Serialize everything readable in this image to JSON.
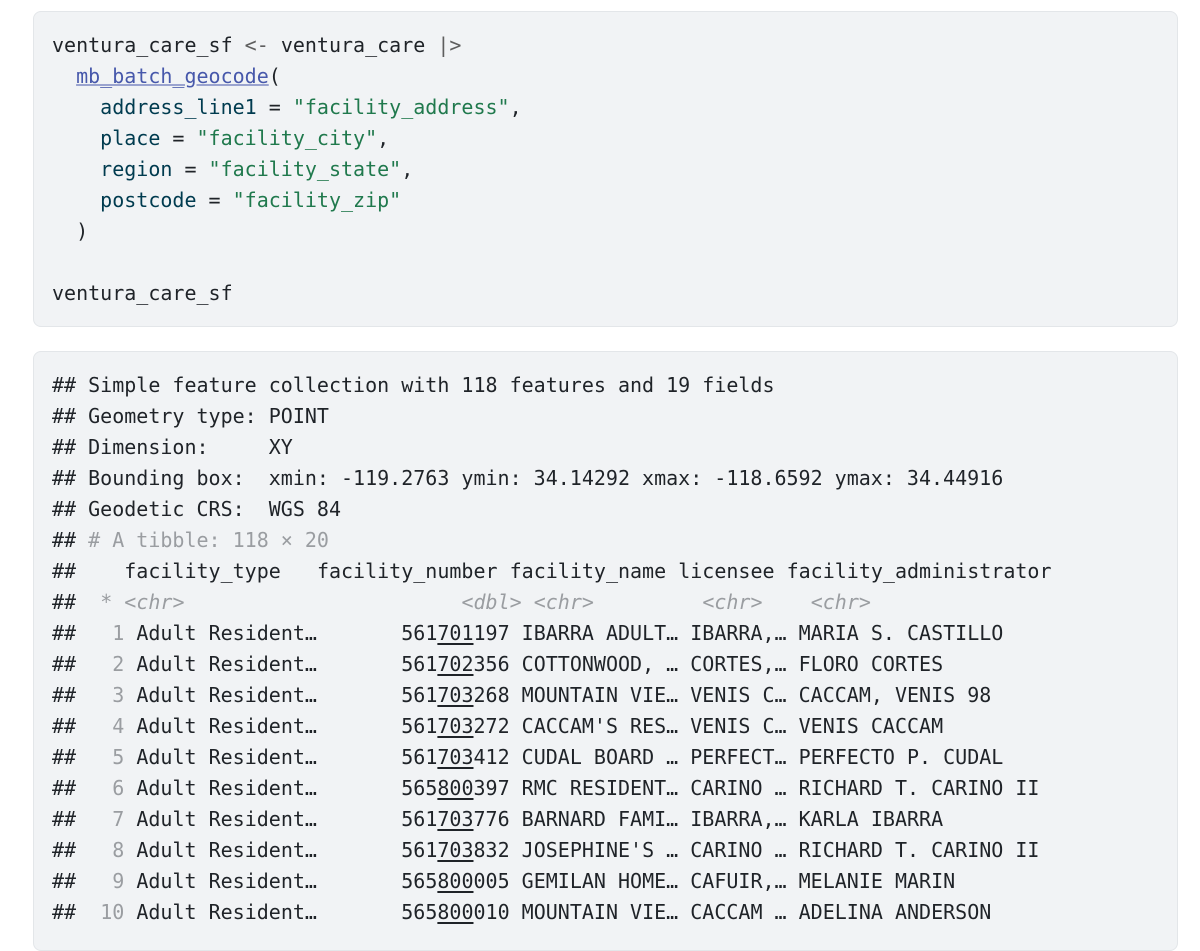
{
  "code": {
    "var": "ventura_care_sf",
    "assign_op": "<-",
    "source": "ventura_care",
    "pipe": "|>",
    "fn": "mb_batch_geocode",
    "open_paren": "(",
    "close_paren": ")",
    "args": [
      {
        "name": "address_line1",
        "eq": " = ",
        "value": "\"facility_address\"",
        "sep": ","
      },
      {
        "name": "place",
        "eq": " = ",
        "value": "\"facility_city\"",
        "sep": ","
      },
      {
        "name": "region",
        "eq": " = ",
        "value": "\"facility_state\"",
        "sep": ","
      },
      {
        "name": "postcode",
        "eq": " = ",
        "value": "\"facility_zip\"",
        "sep": ""
      }
    ],
    "print_var": "ventura_care_sf"
  },
  "output": {
    "prefix": "##",
    "header_lines": [
      "Simple feature collection with 118 features and 19 fields",
      "Geometry type: POINT",
      "Dimension:     XY",
      "Bounding box:  xmin: -119.2763 ymin: 34.14292 xmax: -118.6592 ymax: 34.44916",
      "Geodetic CRS:  WGS 84"
    ],
    "tibble_line": "# A tibble: 118 × 20",
    "columns": [
      "facility_type",
      "facility_number",
      "facility_name",
      "licensee",
      "facility_administrator"
    ],
    "types_star": "*",
    "types": [
      "<chr>",
      "<dbl>",
      "<chr>",
      "<chr>",
      "<chr>"
    ],
    "rows": [
      {
        "n": "1",
        "type": "Adult Resident…",
        "num_a": "561",
        "num_b": "701",
        "num_c": "197",
        "name": "IBARRA ADULT…",
        "licensee": "IBARRA,…",
        "admin": "MARIA S. CASTILLO"
      },
      {
        "n": "2",
        "type": "Adult Resident…",
        "num_a": "561",
        "num_b": "702",
        "num_c": "356",
        "name": "COTTONWOOD, …",
        "licensee": "CORTES,…",
        "admin": "FLORO CORTES"
      },
      {
        "n": "3",
        "type": "Adult Resident…",
        "num_a": "561",
        "num_b": "703",
        "num_c": "268",
        "name": "MOUNTAIN VIE…",
        "licensee": "VENIS C…",
        "admin": "CACCAM, VENIS 98"
      },
      {
        "n": "4",
        "type": "Adult Resident…",
        "num_a": "561",
        "num_b": "703",
        "num_c": "272",
        "name": "CACCAM'S RES…",
        "licensee": "VENIS C…",
        "admin": "VENIS CACCAM"
      },
      {
        "n": "5",
        "type": "Adult Resident…",
        "num_a": "561",
        "num_b": "703",
        "num_c": "412",
        "name": "CUDAL BOARD …",
        "licensee": "PERFECT…",
        "admin": "PERFECTO P. CUDAL"
      },
      {
        "n": "6",
        "type": "Adult Resident…",
        "num_a": "565",
        "num_b": "800",
        "num_c": "397",
        "name": "RMC RESIDENT…",
        "licensee": "CARINO …",
        "admin": "RICHARD T. CARINO II"
      },
      {
        "n": "7",
        "type": "Adult Resident…",
        "num_a": "561",
        "num_b": "703",
        "num_c": "776",
        "name": "BARNARD FAMI…",
        "licensee": "IBARRA,…",
        "admin": "KARLA IBARRA"
      },
      {
        "n": "8",
        "type": "Adult Resident…",
        "num_a": "561",
        "num_b": "703",
        "num_c": "832",
        "name": "JOSEPHINE'S …",
        "licensee": "CARINO …",
        "admin": "RICHARD T. CARINO II"
      },
      {
        "n": "9",
        "type": "Adult Resident…",
        "num_a": "565",
        "num_b": "800",
        "num_c": "005",
        "name": "GEMILAN HOME…",
        "licensee": "CAFUIR,…",
        "admin": "MELANIE MARIN"
      },
      {
        "n": "10",
        "type": "Adult Resident…",
        "num_a": "565",
        "num_b": "800",
        "num_c": "010",
        "name": "MOUNTAIN VIE…",
        "licensee": "CACCAM …",
        "admin": "ADELINA ANDERSON"
      }
    ]
  }
}
